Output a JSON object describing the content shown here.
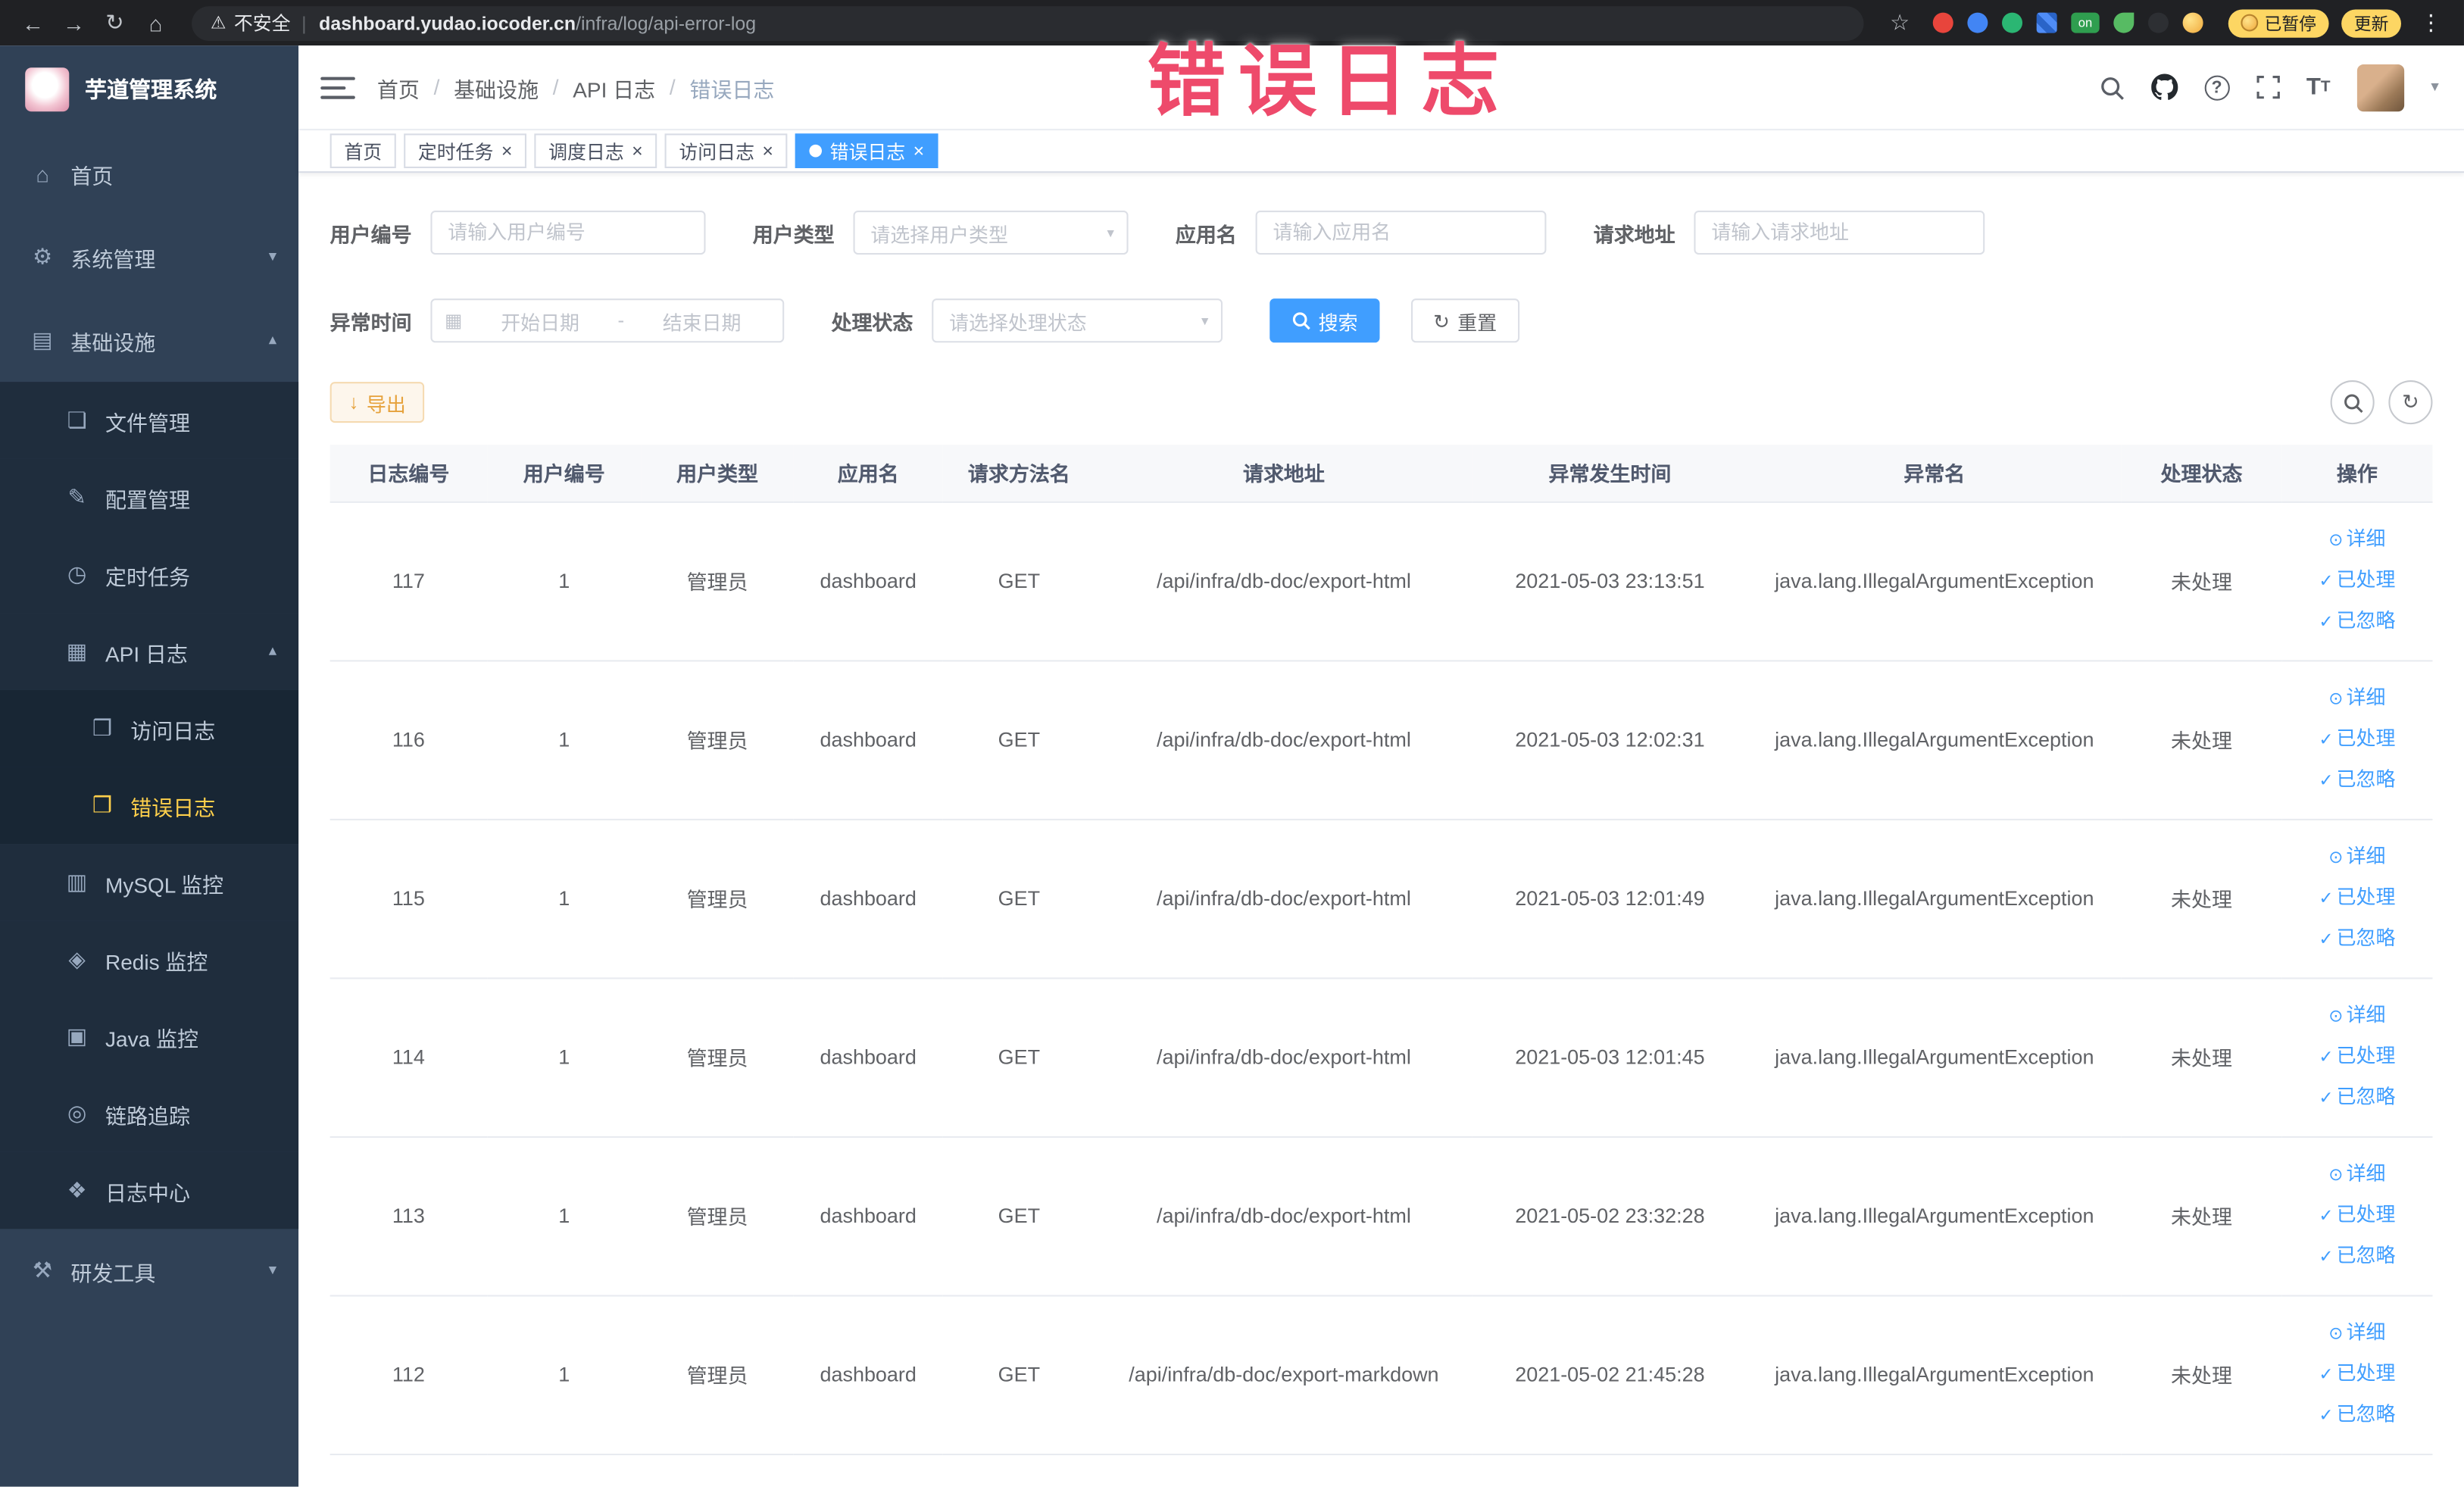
{
  "browser": {
    "security_label": "不安全",
    "url_host": "dashboard.yudao.iocoder.cn",
    "url_path": "/infra/log/api-error-log",
    "omni_separator": "|",
    "extension_on_label": "on",
    "paused_badge": "已暂停",
    "update_button": "更新"
  },
  "annotation": {
    "text": "错误日志",
    "color": "#ee4a6b"
  },
  "sidebar": {
    "logo_title": "芋道管理系统",
    "items": {
      "home": "首页",
      "system": "系统管理",
      "infra": "基础设施",
      "file": "文件管理",
      "config": "配置管理",
      "job": "定时任务",
      "api_log": "API 日志",
      "access_log": "访问日志",
      "error_log": "错误日志",
      "mysql": "MySQL 监控",
      "redis": "Redis 监控",
      "java": "Java 监控",
      "trace": "链路追踪",
      "log_center": "日志中心",
      "dev_tools": "研发工具"
    }
  },
  "header": {
    "breadcrumb": [
      "首页",
      "基础设施",
      "API 日志",
      "错误日志"
    ],
    "breadcrumb_separator": "/"
  },
  "tabs": [
    {
      "label": "首页"
    },
    {
      "label": "定时任务"
    },
    {
      "label": "调度日志"
    },
    {
      "label": "访问日志"
    },
    {
      "label": "错误日志"
    }
  ],
  "filters": {
    "user_id": {
      "label": "用户编号",
      "placeholder": "请输入用户编号"
    },
    "user_type": {
      "label": "用户类型",
      "placeholder": "请选择用户类型"
    },
    "app_name": {
      "label": "应用名",
      "placeholder": "请输入应用名"
    },
    "request_url": {
      "label": "请求地址",
      "placeholder": "请输入请求地址"
    },
    "exception_time": {
      "label": "异常时间",
      "start_placeholder": "开始日期",
      "separator": "-",
      "end_placeholder": "结束日期"
    },
    "process_status": {
      "label": "处理状态",
      "placeholder": "请选择处理状态"
    },
    "search_button": "搜索",
    "reset_button": "重置"
  },
  "toolbar": {
    "export_button": "导出"
  },
  "table": {
    "columns": [
      "日志编号",
      "用户编号",
      "用户类型",
      "应用名",
      "请求方法名",
      "请求地址",
      "异常发生时间",
      "异常名",
      "处理状态",
      "操作"
    ],
    "action_labels": [
      "详细",
      "已处理",
      "已忽略"
    ],
    "rows": [
      {
        "log_id": "117",
        "user_id": "1",
        "user_type": "管理员",
        "app_name": "dashboard",
        "method": "GET",
        "url": "/api/infra/db-doc/export-html",
        "time": "2021-05-03 23:13:51",
        "exception": "java.lang.IllegalArgumentException",
        "status": "未处理"
      },
      {
        "log_id": "116",
        "user_id": "1",
        "user_type": "管理员",
        "app_name": "dashboard",
        "method": "GET",
        "url": "/api/infra/db-doc/export-html",
        "time": "2021-05-03 12:02:31",
        "exception": "java.lang.IllegalArgumentException",
        "status": "未处理"
      },
      {
        "log_id": "115",
        "user_id": "1",
        "user_type": "管理员",
        "app_name": "dashboard",
        "method": "GET",
        "url": "/api/infra/db-doc/export-html",
        "time": "2021-05-03 12:01:49",
        "exception": "java.lang.IllegalArgumentException",
        "status": "未处理"
      },
      {
        "log_id": "114",
        "user_id": "1",
        "user_type": "管理员",
        "app_name": "dashboard",
        "method": "GET",
        "url": "/api/infra/db-doc/export-html",
        "time": "2021-05-03 12:01:45",
        "exception": "java.lang.IllegalArgumentException",
        "status": "未处理"
      },
      {
        "log_id": "113",
        "user_id": "1",
        "user_type": "管理员",
        "app_name": "dashboard",
        "method": "GET",
        "url": "/api/infra/db-doc/export-html",
        "time": "2021-05-02 23:32:28",
        "exception": "java.lang.IllegalArgumentException",
        "status": "未处理"
      },
      {
        "log_id": "112",
        "user_id": "1",
        "user_type": "管理员",
        "app_name": "dashboard",
        "method": "GET",
        "url": "/api/infra/db-doc/export-markdown",
        "time": "2021-05-02 21:45:28",
        "exception": "java.lang.IllegalArgumentException",
        "status": "未处理"
      }
    ]
  }
}
